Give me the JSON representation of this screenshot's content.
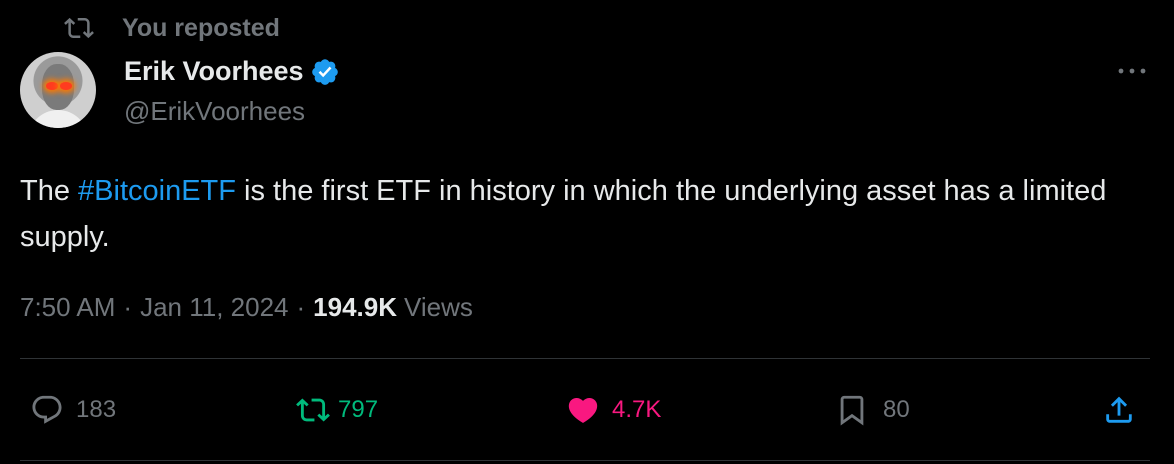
{
  "social_context": {
    "text": "You reposted"
  },
  "author": {
    "name": "Erik Voorhees",
    "handle": "@ErikVoorhees"
  },
  "tweet": {
    "prefix": "The ",
    "hashtag": "#BitcoinETF",
    "suffix": " is the first ETF in history in which the underlying asset has a limited supply."
  },
  "meta": {
    "time": "7:50 AM",
    "date": "Jan 11, 2024",
    "views_count": "194.9K",
    "views_label": "Views",
    "separator": "·"
  },
  "actions": {
    "replies": "183",
    "reposts": "797",
    "likes": "4.7K",
    "bookmarks": "80"
  },
  "colors": {
    "background": "#000000",
    "link": "#1d9bf0",
    "repost_active": "#00ba7c",
    "like_active": "#f91880",
    "muted": "#71767b"
  }
}
